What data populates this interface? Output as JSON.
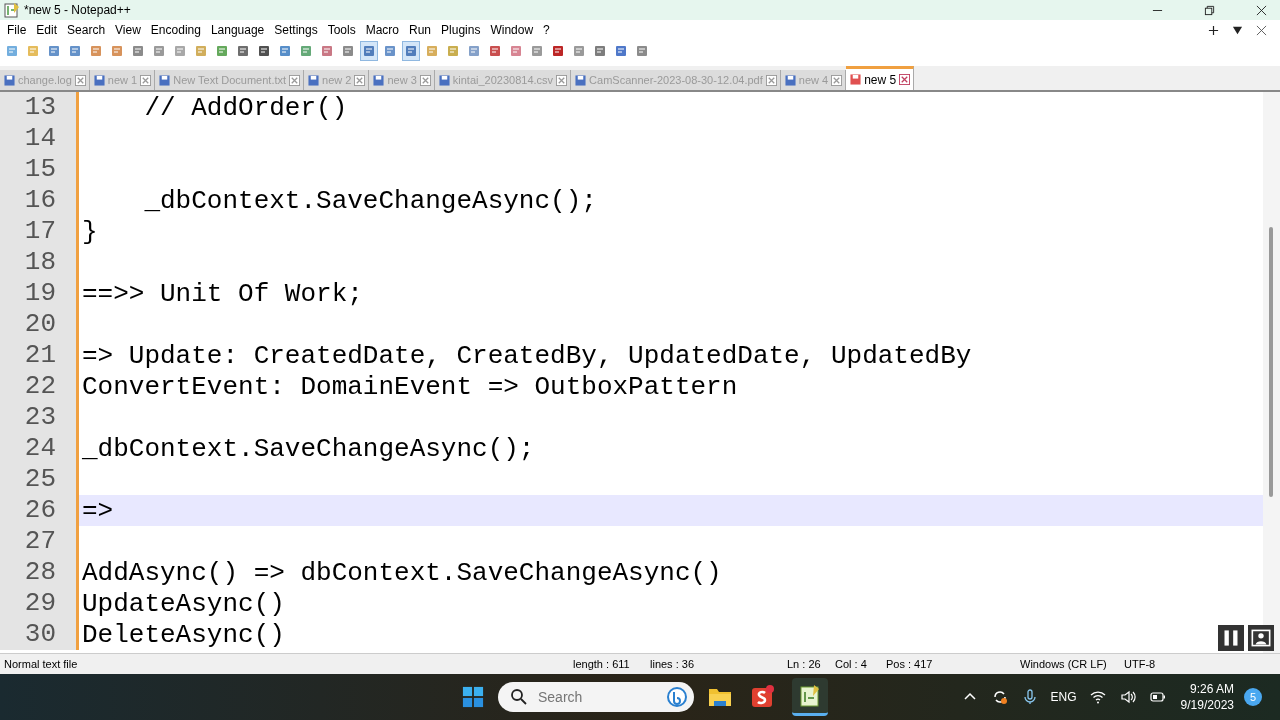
{
  "window": {
    "title": "*new 5 - Notepad++"
  },
  "menu": [
    "File",
    "Edit",
    "Search",
    "View",
    "Encoding",
    "Language",
    "Settings",
    "Tools",
    "Macro",
    "Run",
    "Plugins",
    "Window",
    "?"
  ],
  "toolbar_buttons": [
    {
      "pressed": false
    },
    {
      "pressed": false
    },
    {
      "pressed": false
    },
    {
      "pressed": false
    },
    {
      "pressed": false
    },
    {
      "pressed": false
    },
    {
      "pressed": false
    },
    {
      "pressed": false
    },
    {
      "pressed": false
    },
    {
      "pressed": false
    },
    {
      "pressed": false
    },
    {
      "pressed": false
    },
    {
      "pressed": false
    },
    {
      "pressed": false
    },
    {
      "pressed": false
    },
    {
      "pressed": false
    },
    {
      "pressed": false
    },
    {
      "pressed": true
    },
    {
      "pressed": false
    },
    {
      "pressed": true
    },
    {
      "pressed": false
    },
    {
      "pressed": false
    },
    {
      "pressed": false
    },
    {
      "pressed": false
    },
    {
      "pressed": false
    },
    {
      "pressed": false
    },
    {
      "pressed": false
    },
    {
      "pressed": false
    },
    {
      "pressed": false
    },
    {
      "pressed": false
    },
    {
      "pressed": false
    }
  ],
  "tabs": [
    {
      "label": "change.log",
      "selected": false,
      "unsaved": false
    },
    {
      "label": "new 1",
      "selected": false,
      "unsaved": false
    },
    {
      "label": "New Text Document.txt",
      "selected": false,
      "unsaved": false
    },
    {
      "label": "new 2",
      "selected": false,
      "unsaved": false
    },
    {
      "label": "new 3",
      "selected": false,
      "unsaved": false
    },
    {
      "label": "kintai_20230814.csv",
      "selected": false,
      "unsaved": false
    },
    {
      "label": "CamScanner-2023-08-30-12.04.pdf",
      "selected": false,
      "unsaved": false
    },
    {
      "label": "new 4",
      "selected": false,
      "unsaved": false
    },
    {
      "label": "new 5",
      "selected": true,
      "unsaved": true
    }
  ],
  "lines": [
    {
      "number": "13",
      "text": "    // AddOrder()",
      "current": false
    },
    {
      "number": "14",
      "current": false
    },
    {
      "number": "15",
      "current": false
    },
    {
      "number": "16",
      "text": "    _dbContext.SaveChangeAsync();",
      "current": false
    },
    {
      "number": "17",
      "text": "}",
      "current": false
    },
    {
      "number": "18",
      "current": false
    },
    {
      "number": "19",
      "text": "==>> Unit Of Work;",
      "current": false
    },
    {
      "number": "20",
      "current": false
    },
    {
      "number": "21",
      "text": "=> Update: CreatedDate, CreatedBy, UpdatedDate, UpdatedBy",
      "current": false
    },
    {
      "number": "22",
      "text": "ConvertEvent: DomainEvent => OutboxPattern",
      "current": false
    },
    {
      "number": "23",
      "current": false
    },
    {
      "number": "24",
      "text": "_dbContext.SaveChangeAsync();",
      "current": false
    },
    {
      "number": "25",
      "current": false
    },
    {
      "number": "26",
      "text": "=>",
      "current": true
    },
    {
      "number": "27",
      "current": false
    },
    {
      "number": "28",
      "text": "AddAsync() => dbContext.SaveChangeAsync()",
      "current": false
    },
    {
      "number": "29",
      "text": "UpdateAsync()",
      "current": false
    },
    {
      "number": "30",
      "text": "DeleteAsync()",
      "current": false
    }
  ],
  "status_bar": {
    "file_type": "Normal text file",
    "length": "length : 611",
    "lines": "lines : 36",
    "ln": "Ln : 26",
    "col": "Col : 4",
    "pos": "Pos : 417",
    "eol": "Windows (CR LF)",
    "encoding": "UTF-8"
  },
  "taskbar": {
    "search_placeholder": "Search",
    "language": "ENG",
    "time": "9:26 AM",
    "date": "9/19/2023",
    "notifications": "5"
  }
}
